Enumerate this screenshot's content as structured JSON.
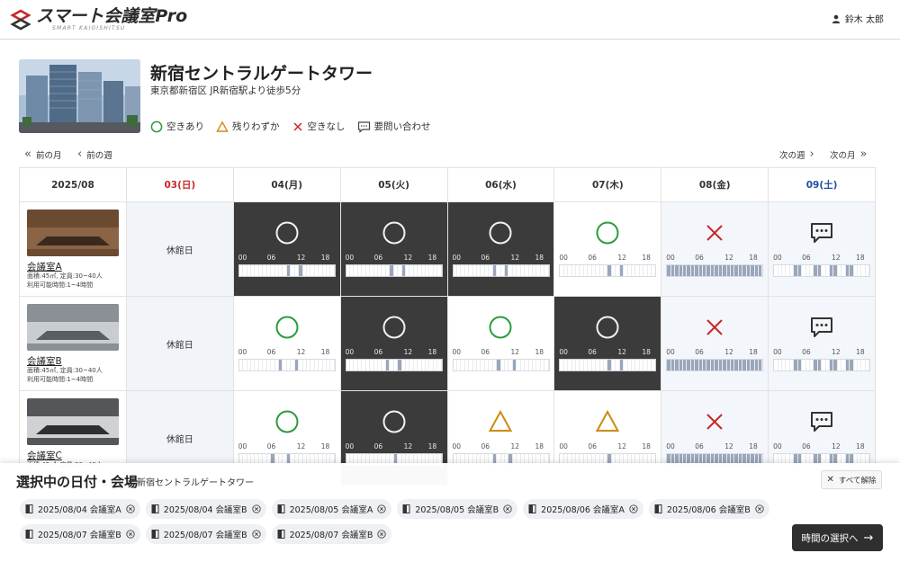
{
  "app": {
    "logo_title": "スマート会議室Pro",
    "logo_sub": "SMART KAIGISHITSU",
    "user_name": "鈴木 太郎"
  },
  "venue": {
    "name": "新宿セントラルゲートタワー",
    "address": "東京都新宿区  JR新宿駅より徒歩5分",
    "legend": [
      {
        "icon": "circle-icon",
        "label": "空きあり",
        "color": "#2e9b3e"
      },
      {
        "icon": "triangle-icon",
        "label": "残りわずか",
        "color": "#d08a12"
      },
      {
        "icon": "cross-icon",
        "label": "空きなし",
        "color": "#c62828"
      },
      {
        "icon": "chat-icon",
        "label": "要問い合わせ",
        "color": "#444444"
      }
    ]
  },
  "nav": {
    "prev_month": "前の月",
    "prev_week": "前の週",
    "next_week": "次の週",
    "next_month": "次の月"
  },
  "calendar": {
    "month": "2025/08",
    "days": [
      "03(日)",
      "04(月)",
      "05(火)",
      "06(水)",
      "07(木)",
      "08(金)",
      "09(土)"
    ],
    "day_types": [
      "sun",
      "weekday",
      "weekday",
      "weekday",
      "weekday",
      "weekday",
      "sat"
    ],
    "closed_label": "休館日",
    "ticks": [
      "00",
      "06",
      "12",
      "18"
    ],
    "rooms": [
      {
        "name": "会議室A",
        "info1": "面積:45㎡, 定員:30~40人",
        "info2": "利用可能時間:1~4時間",
        "cells": [
          {
            "status": "closed"
          },
          {
            "status": "available",
            "selected": true,
            "slots": [
              12,
              15
            ]
          },
          {
            "status": "available",
            "selected": true,
            "slots": [
              11,
              14
            ]
          },
          {
            "status": "available",
            "selected": true,
            "slots": [
              10,
              13
            ]
          },
          {
            "status": "available",
            "selected": false,
            "slots": [
              12,
              15
            ]
          },
          {
            "status": "full",
            "selected": false,
            "slots": []
          },
          {
            "status": "inquiry",
            "selected": false,
            "slots": [
              5,
              10,
              14,
              18
            ]
          }
        ]
      },
      {
        "name": "会議室B",
        "info1": "面積:45㎡, 定員:30~40人",
        "info2": "利用可能時間:1~4時間",
        "cells": [
          {
            "status": "closed"
          },
          {
            "status": "available",
            "selected": false,
            "slots": [
              10,
              14
            ]
          },
          {
            "status": "available",
            "selected": true,
            "slots": [
              10,
              13
            ]
          },
          {
            "status": "available",
            "selected": false,
            "slots": [
              11,
              15
            ]
          },
          {
            "status": "available",
            "selected": true,
            "slots": [
              12,
              15
            ]
          },
          {
            "status": "full",
            "selected": false,
            "slots": []
          },
          {
            "status": "inquiry",
            "selected": false,
            "slots": [
              5,
              10,
              14,
              18
            ]
          }
        ]
      },
      {
        "name": "会議室C",
        "info1": "面積:45㎡, 定員:30~40人",
        "info2": "利用可能時間:1~4時間",
        "cells": [
          {
            "status": "closed"
          },
          {
            "status": "available",
            "selected": false,
            "slots": [
              8,
              12
            ]
          },
          {
            "status": "available",
            "selected": true,
            "slots": [
              12
            ]
          },
          {
            "status": "few",
            "selected": false,
            "slots": [
              10,
              14
            ]
          },
          {
            "status": "few",
            "selected": false,
            "slots": [
              12
            ]
          },
          {
            "status": "full",
            "selected": false,
            "slots": []
          },
          {
            "status": "inquiry",
            "selected": false,
            "slots": [
              5,
              10,
              14,
              18
            ]
          }
        ]
      }
    ]
  },
  "selection": {
    "title": "選択中の日付・会場",
    "venue": "新宿セントラルゲートタワー",
    "clear_label": "すべて解除",
    "chips": [
      "2025/08/04 会議室A",
      "2025/08/04 会議室B",
      "2025/08/05 会議室A",
      "2025/08/05 会議室B",
      "2025/08/06 会議室A",
      "2025/08/06 会議室B",
      "2025/08/07 会議室B",
      "2025/08/07 会議室B",
      "2025/08/07 会議室B"
    ],
    "next_label": "時間の選択へ"
  }
}
